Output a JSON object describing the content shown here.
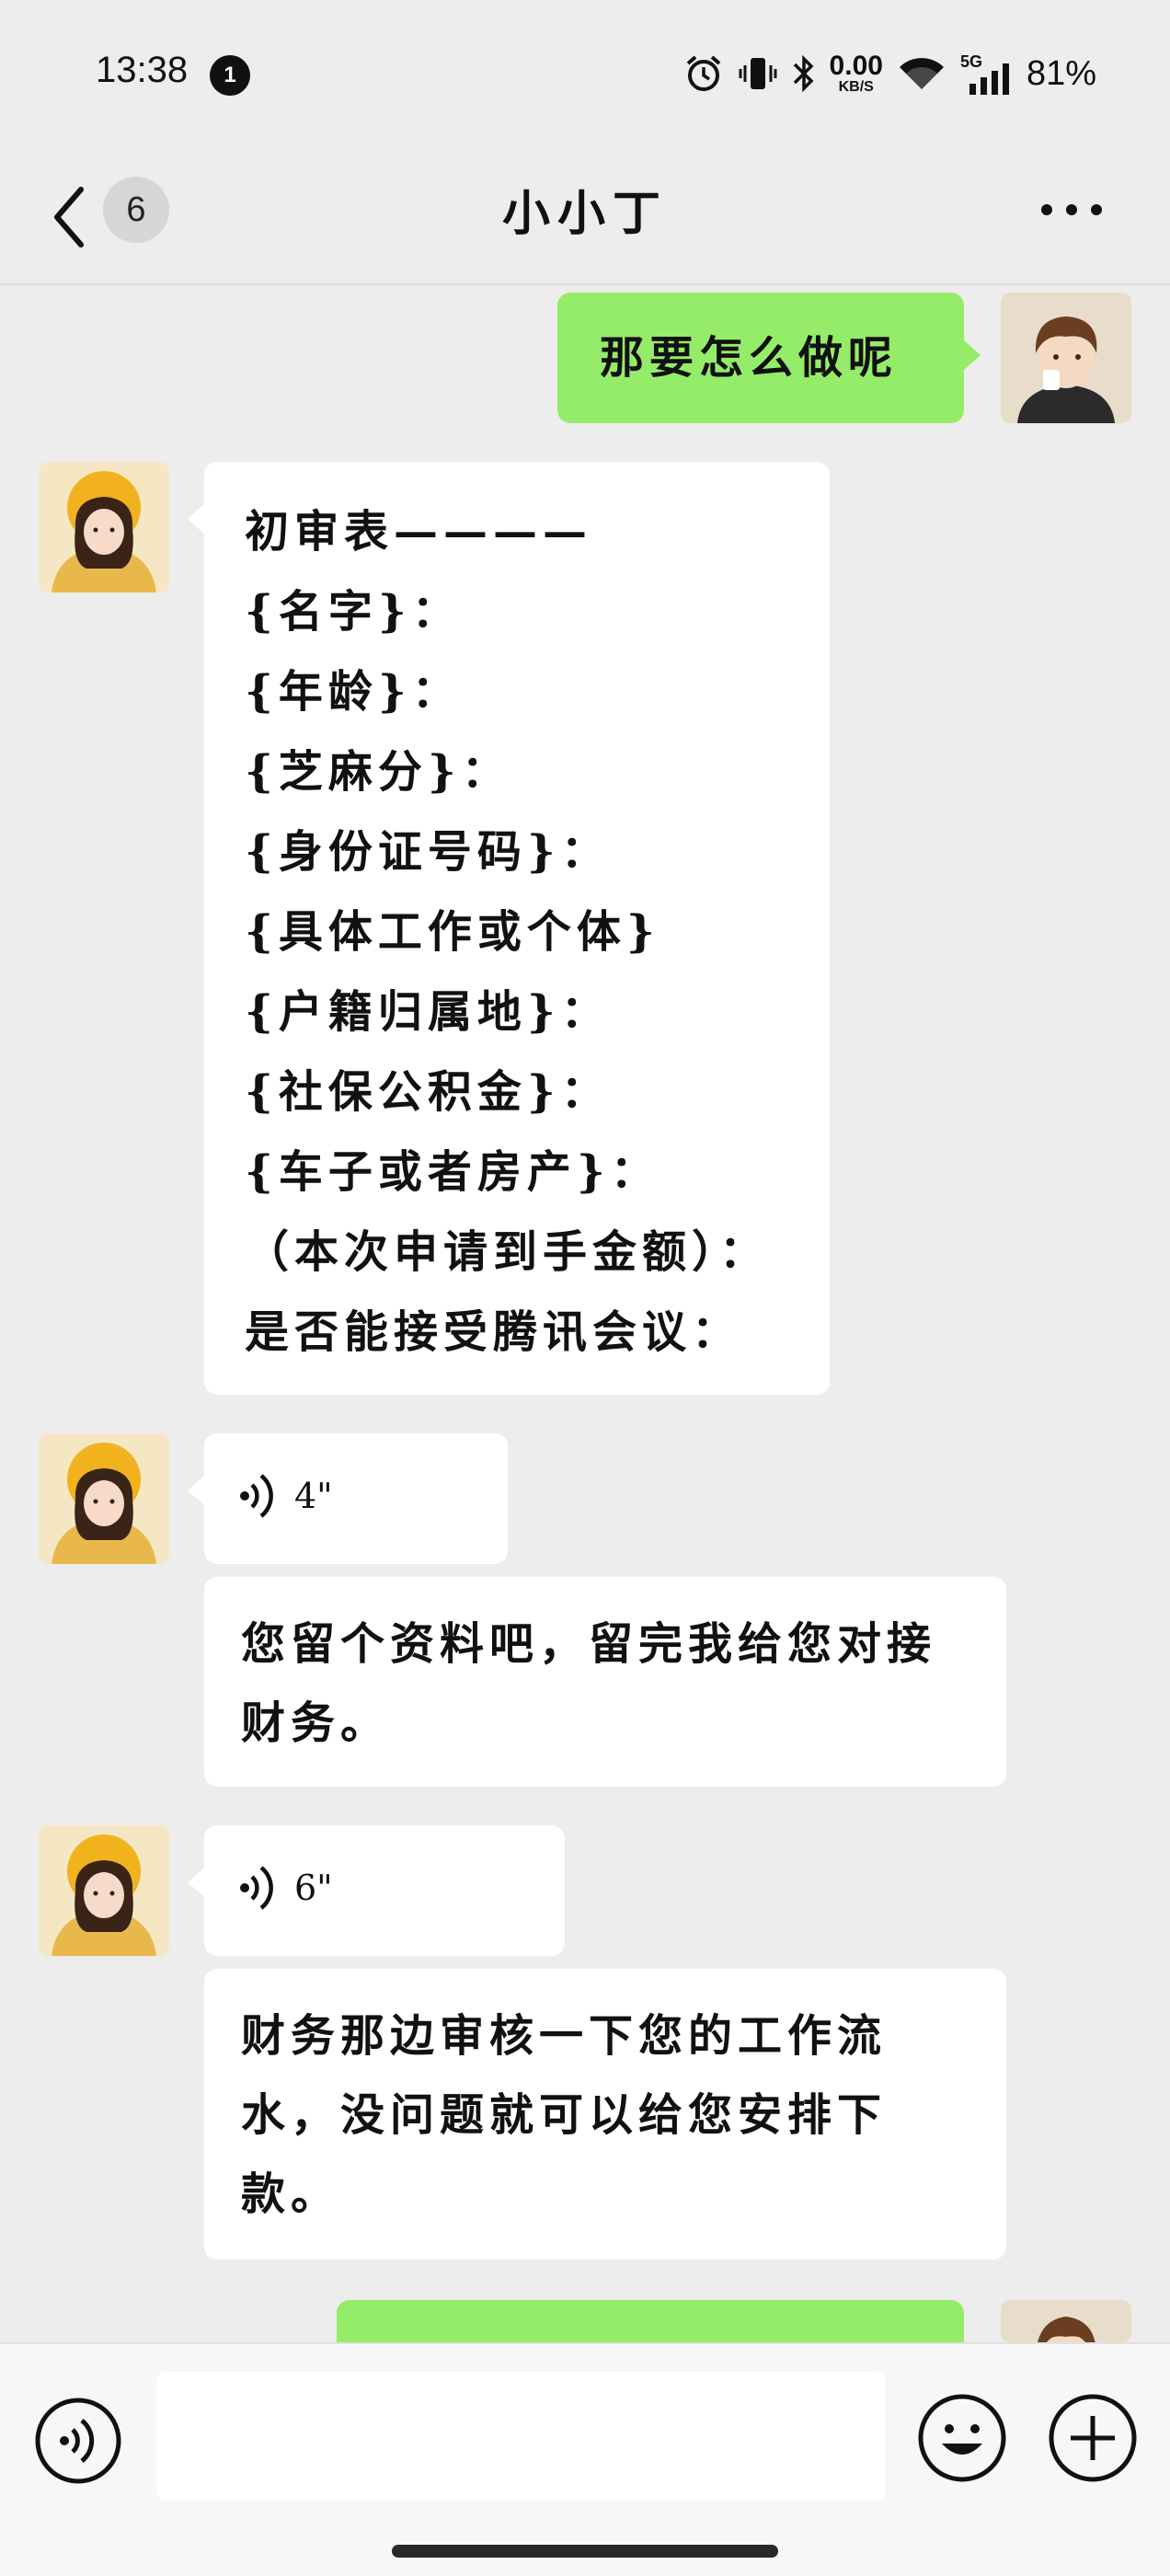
{
  "status_bar": {
    "time": "13:38",
    "notification_count": "1",
    "net_speed_value": "0.00",
    "net_speed_unit": "KB/S",
    "network_type": "5G",
    "battery": "81%"
  },
  "header": {
    "unread_count": "6",
    "title": "小小丁"
  },
  "messages": [
    {
      "side": "right",
      "type": "text",
      "text": "那要怎么做呢"
    },
    {
      "side": "left",
      "type": "form",
      "lines": [
        "初审表————",
        "{名字}：",
        "{年龄}：",
        "{芝麻分}：",
        "{身份证号码}：",
        "{具体工作或个体}",
        "{户籍归属地}：",
        "{社保公积金}：",
        "{车子或者房产}：",
        "（本次申请到手金额）：",
        "是否能接受腾讯会议："
      ]
    },
    {
      "side": "left",
      "type": "voice",
      "duration": "4\""
    },
    {
      "side": "left",
      "type": "text",
      "text": "您留个资料吧，留完我给您对接财务。"
    },
    {
      "side": "left",
      "type": "voice",
      "duration": "6\""
    },
    {
      "side": "left",
      "type": "text",
      "text": "财务那边审核一下您的工作流水，没问题就可以给您安排下款。"
    },
    {
      "side": "right",
      "type": "text",
      "text": ""
    }
  ],
  "input": {
    "value": "",
    "placeholder": ""
  },
  "icons": {
    "back": "chevron-left-icon",
    "more": "more-dots-icon",
    "voice": "voice-icon",
    "emoji": "emoji-icon",
    "plus": "plus-icon"
  },
  "colors": {
    "background": "#ededed",
    "sent_bubble": "#95ec69",
    "received_bubble": "#ffffff"
  }
}
